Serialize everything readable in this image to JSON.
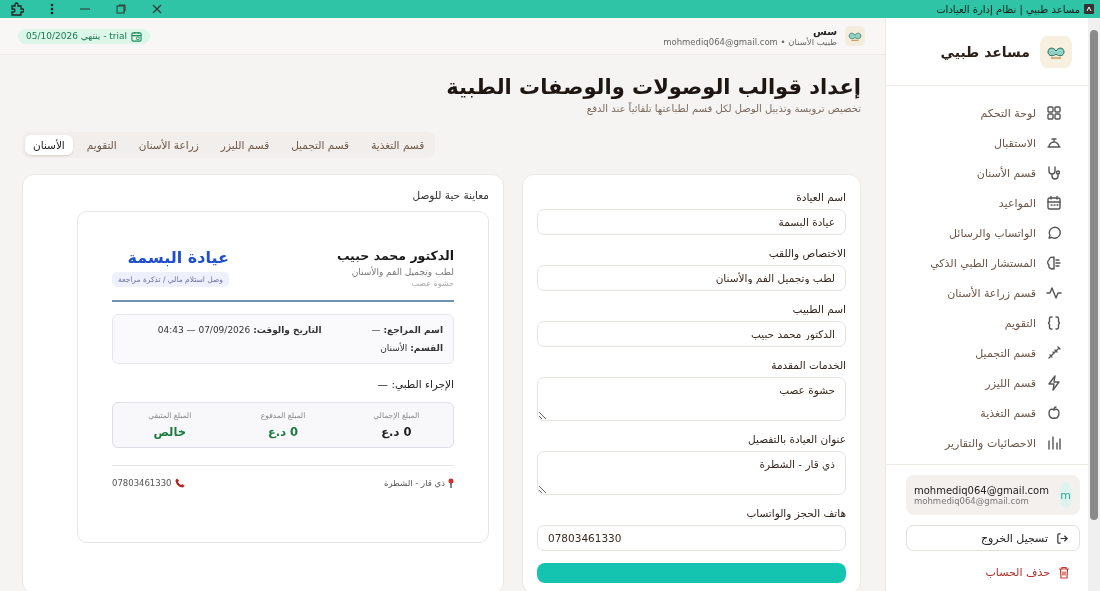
{
  "window": {
    "title": "مساعد طبيي | نظام إدارة العيادات"
  },
  "sidebar": {
    "app_name": "مساعد طبيي",
    "items": [
      {
        "label": "لوحة التحكم",
        "selected": false
      },
      {
        "label": "الاستقبال",
        "selected": false
      },
      {
        "label": "قسم الأسنان",
        "selected": false
      },
      {
        "label": "المواعيد",
        "selected": false
      },
      {
        "label": "الواتساب والرسائل",
        "selected": false
      },
      {
        "label": "المستشار الطبي الذكي",
        "selected": false
      },
      {
        "label": "قسم زراعة الأسنان",
        "selected": false
      },
      {
        "label": "التقويم",
        "selected": false
      },
      {
        "label": "قسم التجميل",
        "selected": false
      },
      {
        "label": "قسم الليزر",
        "selected": false
      },
      {
        "label": "قسم التغذية",
        "selected": false
      },
      {
        "label": "الاحصائيات والتقارير",
        "selected": false
      }
    ],
    "user": {
      "avatar": "m",
      "name": "mohmediq064@gmail.com",
      "email": "mohmediq064@gmail.com"
    },
    "logout": "تسجيل الخروج",
    "delete_account": "حذف الحساب"
  },
  "header": {
    "user_name": "سس",
    "user_sub": "طبيب الأسنان • mohmediq064@gmail.com",
    "trial_badge": "trial - ينتهي 05/10/2026"
  },
  "page": {
    "title": "إعداد قوالب الوصولات والوصفات الطبية",
    "subtitle": "تخصيص ترويسة وتذييل الوصل لكل قسم لطباعتها تلقائياً عند الدفع"
  },
  "tabs": [
    {
      "label": "قسم التغذية",
      "selected": false
    },
    {
      "label": "قسم التجميل",
      "selected": false
    },
    {
      "label": "قسم الليزر",
      "selected": false
    },
    {
      "label": "زراعة الأسنان",
      "selected": false
    },
    {
      "label": "التقويم",
      "selected": false
    },
    {
      "label": "الأسنان",
      "selected": true
    }
  ],
  "form": {
    "fields": [
      {
        "label": "اسم العيادة",
        "value": "عيادة البسمة",
        "kind": "input"
      },
      {
        "label": "الاختصاص واللقب",
        "value": "لطب وتجميل الفم والأسنان",
        "kind": "input"
      },
      {
        "label": "اسم الطبيب",
        "value": "الدكتور محمد حبيب",
        "kind": "input"
      },
      {
        "label": "الخدمات المقدمة",
        "value": "حشوة عصب",
        "kind": "textarea"
      },
      {
        "label": "عنوان العيادة بالتفصيل",
        "value": "ذي قار - الشطرة",
        "kind": "textarea"
      },
      {
        "label": "هاتف الحجز والواتساب",
        "value": "07803461330",
        "kind": "phone"
      }
    ]
  },
  "preview": {
    "title": "معاينة حية للوصل",
    "receipt": {
      "doctor": "الدكتور محمد حبيب",
      "specialty": "لطب وتجميل الفم والأسنان",
      "services": "حشوة عصب",
      "clinic": "عيادة البسمة",
      "receipt_type": "وصل استلام مالي / تذكرة مراجعة",
      "patient": "**اسم المراجع:** —",
      "datetime": "**التاريخ والوقت:** 07/09/2026 — 04:43",
      "department": "**القسم:** الأسنان",
      "procedure": "الإجراء الطبي: —",
      "amounts": [
        {
          "label": "المبلغ الإجمالي",
          "value": "0 د.ع",
          "kind": "plain"
        },
        {
          "label": "المبلغ المدفوع",
          "value": "0 د.ع",
          "kind": "paid"
        },
        {
          "label": "المبلغ المتبقي",
          "value": "خالص",
          "kind": "paid"
        }
      ],
      "address": "ذي قار - الشطرة",
      "phone": "07803461330"
    }
  }
}
